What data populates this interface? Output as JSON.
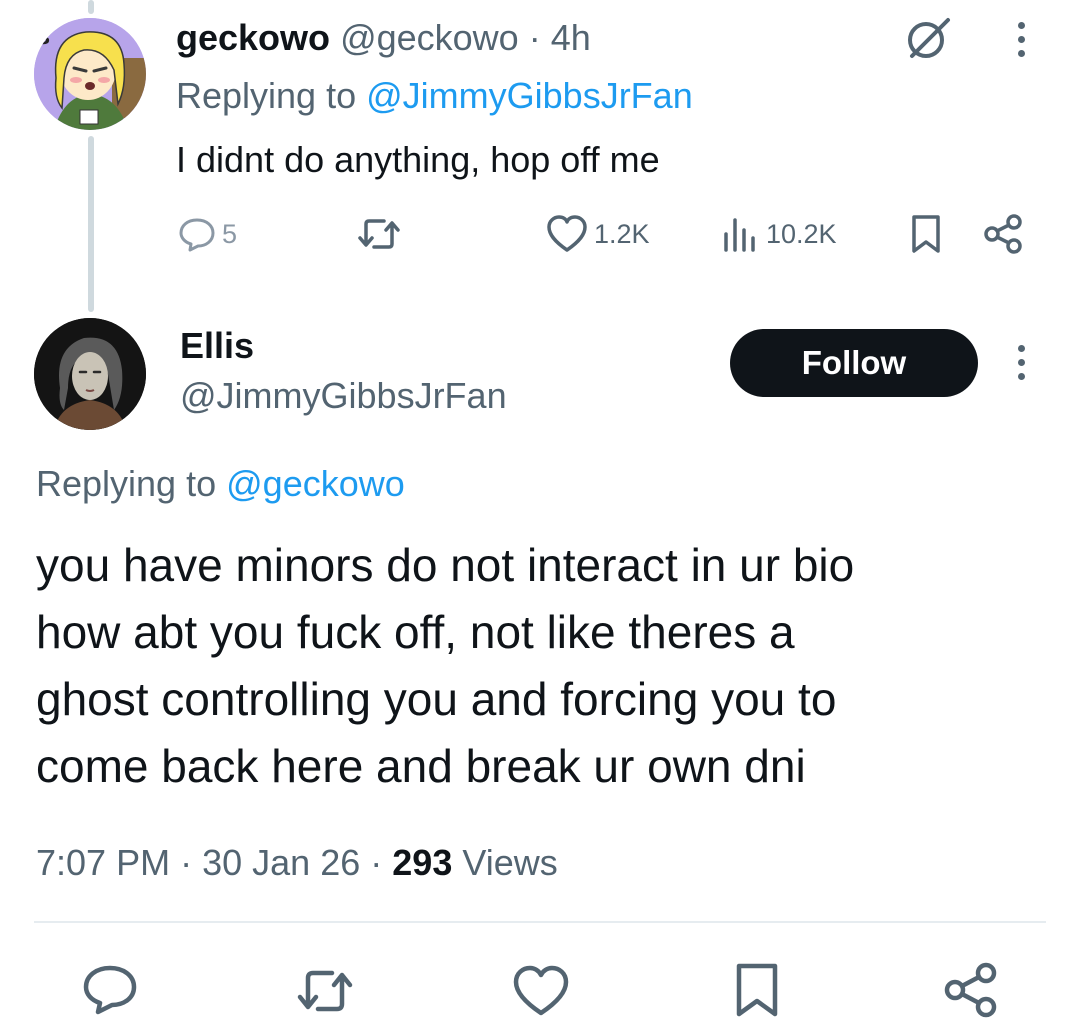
{
  "reply_tweet": {
    "display_name": "geckowo",
    "handle": "@geckowo",
    "separator": "·",
    "time_ago": "4h",
    "replying_prefix": "Replying to",
    "replying_to": "@JimmyGibbsJrFan",
    "text": "I didnt do anything, hop off me",
    "replies": "5",
    "likes": "1.2K",
    "views": "10.2K"
  },
  "main_tweet": {
    "display_name": "Ellis",
    "handle": "@JimmyGibbsJrFan",
    "follow_label": "Follow",
    "replying_prefix": "Replying to",
    "replying_to": "@geckowo",
    "text_lines": [
      "you have minors do not interact in ur bio",
      "how abt you fuck off, not like theres a",
      "ghost controlling you and forcing you to",
      "come back here and break ur own dni"
    ],
    "time": "7:07 PM",
    "sep1": "·",
    "date": "30 Jan 26",
    "sep2": "·",
    "views_count": "293",
    "views_label": "Views"
  },
  "icons": {
    "reply": "reply-icon",
    "retweet": "retweet-icon",
    "like": "heart-icon",
    "views": "views-chart-icon",
    "bookmark": "bookmark-icon",
    "share": "share-icon",
    "grok": "grok-icon",
    "more": "more-icon"
  },
  "colors": {
    "text": "#0f1419",
    "muted": "#536471",
    "link": "#1d9bf0",
    "thread_line": "#cfd9de",
    "follow_bg": "#0f1419"
  }
}
